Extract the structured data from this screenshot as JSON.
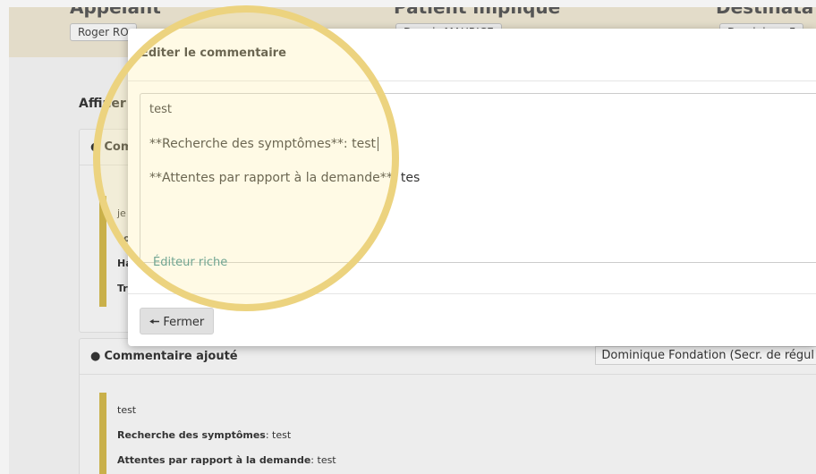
{
  "background": {
    "header": {
      "col1_title": "Appelant",
      "col1_chip": "Roger RO",
      "col2_title": "Patient impliqué",
      "col2_chip": "Dupuis MAURICE",
      "col3_title": "Destinata",
      "col3_chip": "Dominique F"
    },
    "affiner_label": "Affiner",
    "panel1": {
      "title": "Com",
      "lines": [
        "je",
        "Lo",
        "Ha",
        "Tr"
      ]
    },
    "panel2": {
      "title": "Commentaire ajouté",
      "author": "Dominique Fondation (Secr. de régul",
      "quote": {
        "text": "test",
        "line2_label": "Recherche des symptômes",
        "line2_value": ": test",
        "line3_label": "Attentes par rapport à la demande",
        "line3_value": ": test"
      }
    }
  },
  "modal": {
    "title": "Éditer le commentaire",
    "editor": {
      "line1": "test",
      "line2": "**Recherche des symptômes**:  test",
      "line3": "**Attentes par rapport à la demande**:  tes"
    },
    "rich_editor_link": "Éditeur riche",
    "close_button": "Fermer",
    "close_icon": "arrow-left-icon"
  },
  "colors": {
    "accent_link": "#3a8a8c",
    "quote_bar": "#c9b04a",
    "magnifier_ring": "#ecd37f"
  }
}
